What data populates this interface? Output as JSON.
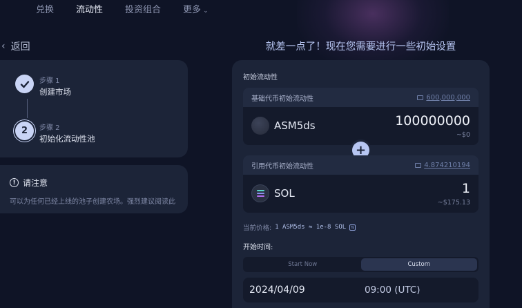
{
  "nav": {
    "items": [
      {
        "label": "兑换"
      },
      {
        "label": "流动性"
      },
      {
        "label": "投资组合"
      },
      {
        "label": "更多"
      }
    ]
  },
  "back": {
    "label": "返回"
  },
  "steps": [
    {
      "label": "步骤 1",
      "title": "创建市场",
      "status": "done"
    },
    {
      "label": "步骤 2",
      "title": "初始化流动性池",
      "number": "2",
      "status": "current"
    }
  ],
  "notice": {
    "title": "请注意",
    "text": "可以为任何已经上线的池子创建农场。强烈建议阅读此"
  },
  "setup": {
    "heading": "就差一点了！现在您需要进行一些初始设置",
    "section_label": "初始流动性",
    "base": {
      "label": "基础代币初始流动性",
      "balance": "600,000,000",
      "token": "ASM5ds",
      "amount": "100000000",
      "usd": "~$0"
    },
    "quote": {
      "label": "引用代币初始流动性",
      "balance": "4.874210194",
      "token": "SOL",
      "amount": "1",
      "usd": "~$175.13"
    },
    "price_label": "当前价格:",
    "price_value": "1 ASM5ds ≈ 1e-8 SOL",
    "start_label": "开始时间:",
    "toggle": {
      "start_now": "Start Now",
      "custom": "Custom",
      "selected": "custom"
    },
    "date": "2024/04/09",
    "time": "09:00 (UTC)"
  },
  "colors": {
    "background": "#0f1426",
    "card": "#1c2438",
    "accent": "#b7c6f2",
    "heading": "#b9c8f5"
  }
}
